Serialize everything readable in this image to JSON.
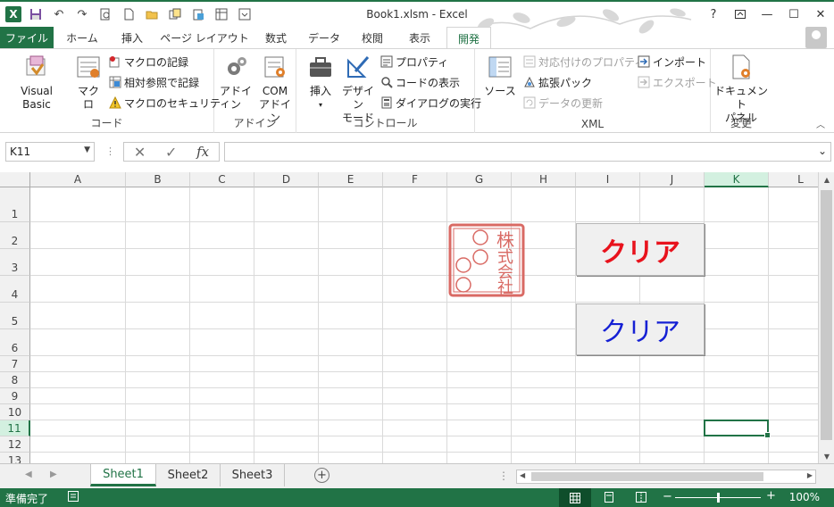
{
  "window": {
    "title": "Book1.xlsm - Excel",
    "help": "?",
    "app_icon": "X"
  },
  "tabs": {
    "file": "ファイル",
    "items": [
      "ホーム",
      "挿入",
      "ページ レイアウト",
      "数式",
      "データ",
      "校閲",
      "表示",
      "開発"
    ],
    "active": "開発"
  },
  "ribbon": {
    "code": {
      "label": "コード",
      "visual_basic": "Visual Basic",
      "macro": "マクロ",
      "record_macro": "マクロの記録",
      "relative_ref": "相対参照で記録",
      "macro_security": "マクロのセキュリティ"
    },
    "addins": {
      "label": "アドイン",
      "addin": "アドイン",
      "com_addin_1": "COM",
      "com_addin_2": "アドイン"
    },
    "controls": {
      "label": "コントロール",
      "insert": "挿入",
      "design_mode_1": "デザイン",
      "design_mode_2": "モード",
      "properties": "プロパティ",
      "view_code": "コードの表示",
      "run_dialog": "ダイアログの実行"
    },
    "xml": {
      "label": "XML",
      "source": "ソース",
      "map_properties": "対応付けのプロパティ",
      "expansion_packs": "拡張パック",
      "refresh_data": "データの更新",
      "import": "インポート",
      "export": "エクスポート"
    },
    "modify": {
      "label": "変更",
      "doc_panel_1": "ドキュメント",
      "doc_panel_2": "パネル"
    }
  },
  "formula_bar": {
    "name_box": "K11",
    "fx": "fx",
    "value": ""
  },
  "columns": [
    "A",
    "B",
    "C",
    "D",
    "E",
    "F",
    "G",
    "H",
    "I",
    "J",
    "K",
    "L"
  ],
  "rows": [
    "1",
    "2",
    "3",
    "4",
    "5",
    "6",
    "7",
    "8",
    "9",
    "10",
    "11",
    "12",
    "13"
  ],
  "selected_cell": "K11",
  "buttons": {
    "clear_red": "クリア",
    "clear_blue": "クリア",
    "red_color": "#e8121c",
    "blue_color": "#1520d4"
  },
  "seal": {
    "chars": [
      "株",
      "式",
      "会",
      "社"
    ],
    "color": "#d9534f"
  },
  "sheets": [
    "Sheet1",
    "Sheet2",
    "Sheet3"
  ],
  "active_sheet": "Sheet1",
  "status": {
    "ready": "準備完了",
    "zoom": "100%",
    "zoom_percent": 100
  }
}
